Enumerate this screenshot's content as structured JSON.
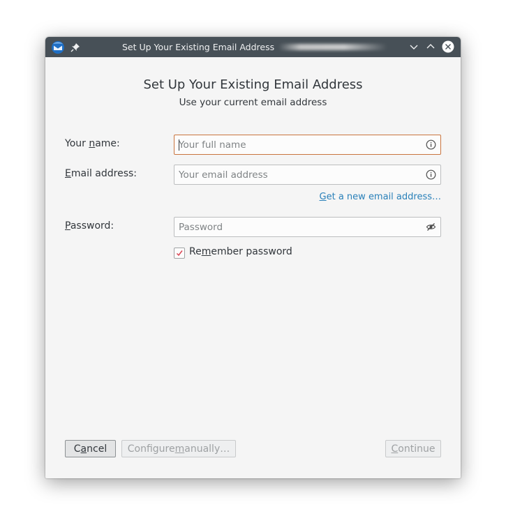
{
  "window": {
    "title": "Set Up Your Existing Email Address"
  },
  "heading": "Set Up Your Existing Email Address",
  "subheading": "Use your current email address",
  "form": {
    "name": {
      "label_pre": "Your ",
      "label_accel": "n",
      "label_post": "ame:",
      "placeholder": "Your full name",
      "value": "",
      "icon": "info-icon"
    },
    "email": {
      "label_pre": "",
      "label_accel": "E",
      "label_post": "mail address:",
      "placeholder": "Your email address",
      "value": "",
      "icon": "info-icon"
    },
    "new_email_link": {
      "accel": "G",
      "rest": "et a new email address…"
    },
    "password": {
      "label_pre": "",
      "label_accel": "P",
      "label_post": "assword:",
      "placeholder": "Password",
      "value": "",
      "icon": "eye-slash-icon"
    },
    "remember": {
      "label_pre": "Re",
      "label_accel": "m",
      "label_post": "ember password",
      "checked": true
    }
  },
  "buttons": {
    "cancel": {
      "pre": "C",
      "accel": "a",
      "post": "ncel"
    },
    "manual": {
      "pre": "Configure ",
      "accel": "m",
      "post": "anually…"
    },
    "continue": {
      "pre": "",
      "accel": "C",
      "post": "ontinue"
    }
  },
  "colors": {
    "titlebar": "#475057",
    "focus_border": "#c9743e",
    "link": "#2980b9",
    "checkmark": "#da4453"
  }
}
